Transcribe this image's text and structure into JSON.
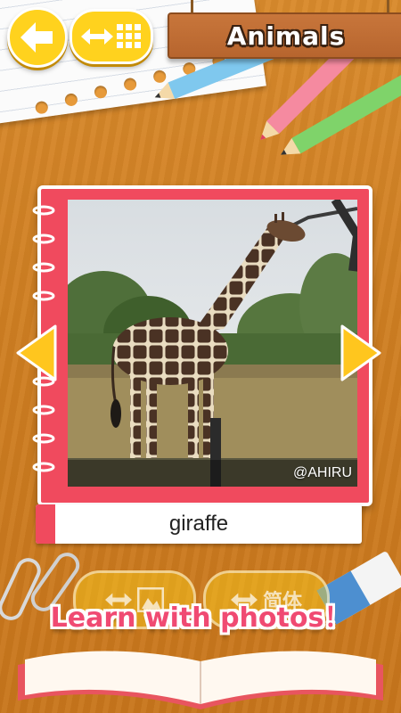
{
  "header": {
    "title": "Animals",
    "back_icon": "arrow-left-icon",
    "menu_icon": "grid-switch-icon"
  },
  "card": {
    "image_subject": "giraffe",
    "credit": "@AHIRU",
    "caption": "giraffe",
    "prev_icon": "triangle-left-icon",
    "next_icon": "triangle-right-icon"
  },
  "bottom": {
    "left_button_icon": "photo-switch-icon",
    "right_button_text": "简体",
    "slogan": "Learn with photos！"
  },
  "colors": {
    "accent_red": "#f04a5e",
    "button_yellow": "#ffd21e",
    "slogan_pink": "#f04a72",
    "wood": "#d98a2c"
  }
}
